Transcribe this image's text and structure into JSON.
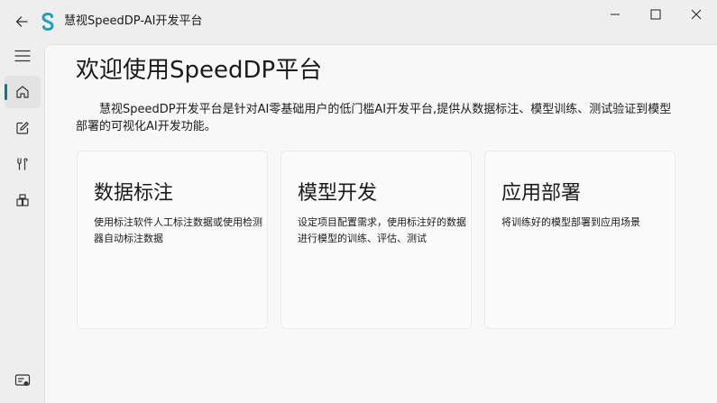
{
  "window": {
    "title": "慧视SpeedDP-AI开发平台"
  },
  "sidebar": {
    "items": [
      {
        "icon": "menu-icon"
      },
      {
        "icon": "home-icon",
        "active": true
      },
      {
        "icon": "edit-icon"
      },
      {
        "icon": "tools-icon"
      },
      {
        "icon": "apps-icon"
      },
      {
        "icon": "account-icon"
      }
    ]
  },
  "main": {
    "title": "欢迎使用SpeedDP平台",
    "description": "慧视SpeedDP开发平台是针对AI零基础用户的低门槛AI开发平台,提供从数据标注、模型训练、测试验证到模型部署的可视化AI开发功能。",
    "cards": [
      {
        "title": "数据标注",
        "description": "使用标注软件人工标注数据或使用检测器自动标注数据"
      },
      {
        "title": "模型开发",
        "description": "设定项目配置需求，使用标注好的数据进行模型的训练、评估、测试"
      },
      {
        "title": "应用部署",
        "description": "将训练好的模型部署到应用场景"
      }
    ]
  },
  "colors": {
    "accent": "#0b7a8f",
    "logo": "#1aa3b8",
    "window_bg": "#eeeeee",
    "content_bg": "#f8f8f8"
  }
}
